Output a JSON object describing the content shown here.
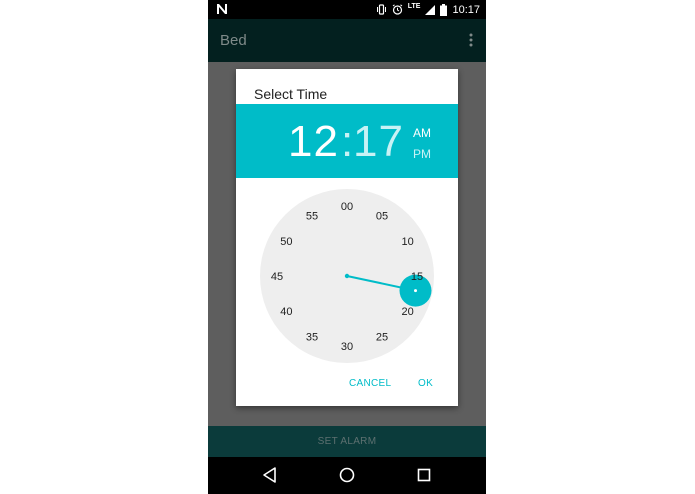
{
  "status_bar": {
    "time": "10:17",
    "network": "LTE",
    "icons": [
      "notification-n-icon",
      "vibrate-icon",
      "alarm-icon",
      "lte-signal-icon",
      "battery-icon"
    ]
  },
  "app_bar": {
    "title": "Bed",
    "overflow_icon": "more-vert-icon"
  },
  "dialog": {
    "title": "Select Time",
    "hour": "12",
    "separator": ":",
    "minute": "17",
    "am": "AM",
    "pm": "PM",
    "selected_period": "AM",
    "clock": {
      "labels": [
        "00",
        "05",
        "10",
        "15",
        "20",
        "25",
        "30",
        "35",
        "40",
        "45",
        "50",
        "55"
      ],
      "selected_minute": 17,
      "face_color": "#eeeeee",
      "accent_color": "#00bcc8"
    },
    "cancel_label": "CANCEL",
    "ok_label": "OK"
  },
  "bottom_button": {
    "label": "SET ALARM"
  },
  "nav_bar": {
    "icons": [
      "back-icon",
      "home-icon",
      "recents-icon"
    ]
  },
  "colors": {
    "accent": "#00bcc8",
    "app_bar": "#03201f",
    "bottom_button": "#0b3b3b",
    "scrim": "#5e5e5e"
  }
}
